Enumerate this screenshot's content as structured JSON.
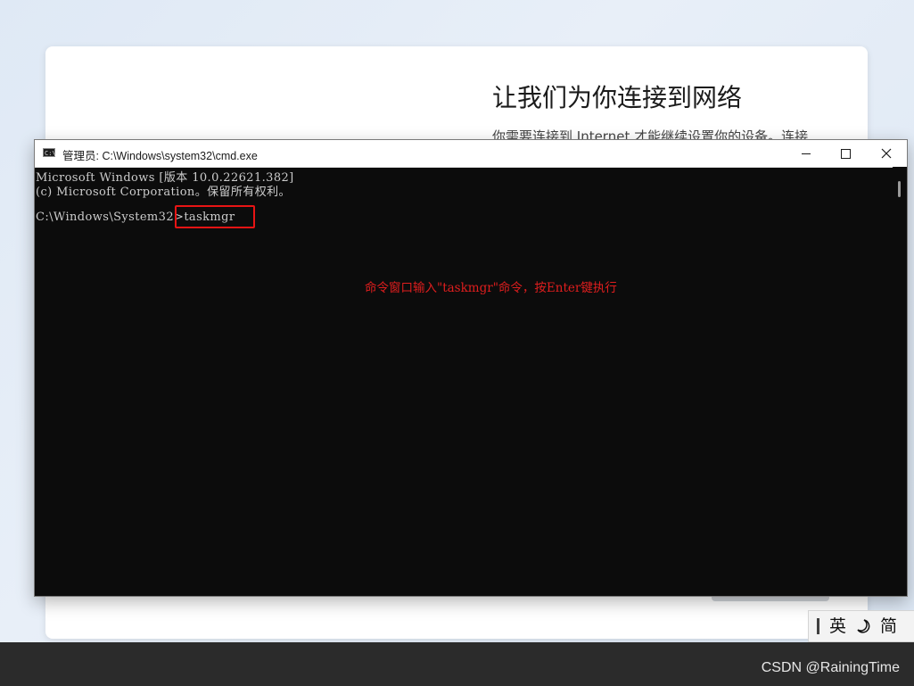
{
  "oobe": {
    "title": "让我们为你连接到网络",
    "subtitle": "你需要连接到 Internet 才能继续设置你的设备。连接"
  },
  "cmd": {
    "title": "管理员: C:\\Windows\\system32\\cmd.exe",
    "app_icon_text": "C:\\",
    "controls": {
      "minimize": "minimize-icon",
      "maximize": "maximize-icon",
      "close": "close-icon"
    },
    "lines": [
      "Microsoft Windows [版本 10.0.22621.382]",
      "(c) Microsoft Corporation。保留所有权利。"
    ],
    "prompt": "C:\\Windows\\System32>",
    "command": "taskmgr",
    "annotation": "命令窗口输入\"taskmgr\"命令，按Enter键执行",
    "highlight_color": "#e81414",
    "background_color": "#0c0c0c",
    "text_color": "#cccccc"
  },
  "ime": {
    "lang": "英",
    "mode_icon": "moon-icon",
    "script": "简"
  },
  "watermark": "CSDN @RainingTime"
}
